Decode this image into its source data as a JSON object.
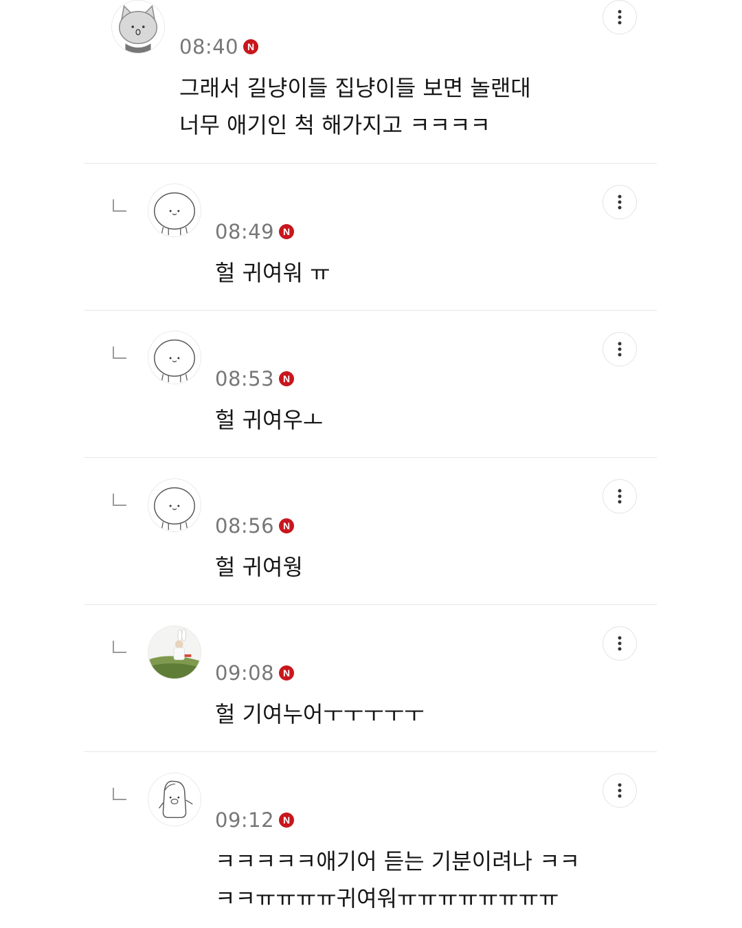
{
  "comments": [
    {
      "time": "08:40",
      "badge": "N",
      "lines": [
        "그래서 길냥이들 집냥이들 보면 놀랜대",
        "너무 애기인 척 해가지고 ㅋㅋㅋㅋ"
      ],
      "avatar": "gray-cat-avatar"
    },
    {
      "time": "08:49",
      "badge": "N",
      "lines": [
        "헐 귀여워 ㅠ"
      ],
      "avatar": "white-blob-avatar"
    },
    {
      "time": "08:53",
      "badge": "N",
      "lines": [
        "헐 귀여우ㅗ"
      ],
      "avatar": "white-blob-avatar"
    },
    {
      "time": "08:56",
      "badge": "N",
      "lines": [
        "헐 귀여웡"
      ],
      "avatar": "white-blob-avatar"
    },
    {
      "time": "09:08",
      "badge": "N",
      "lines": [
        "헐 기여누어ㅜㅜㅜㅜㅜ"
      ],
      "avatar": "photo-avatar"
    },
    {
      "time": "09:12",
      "badge": "N",
      "lines": [
        "ㅋㅋㅋㅋㅋ애기어 듣는 기분이려나 ㅋㅋ",
        "ㅋㅋㅠㅠㅠㅠ귀여워ㅠㅠㅠㅠㅠㅠㅠㅠ"
      ],
      "avatar": "pig-avatar"
    }
  ],
  "colors": {
    "badge": "#c8161d",
    "time": "#777777",
    "divider": "#e6e6e6"
  }
}
